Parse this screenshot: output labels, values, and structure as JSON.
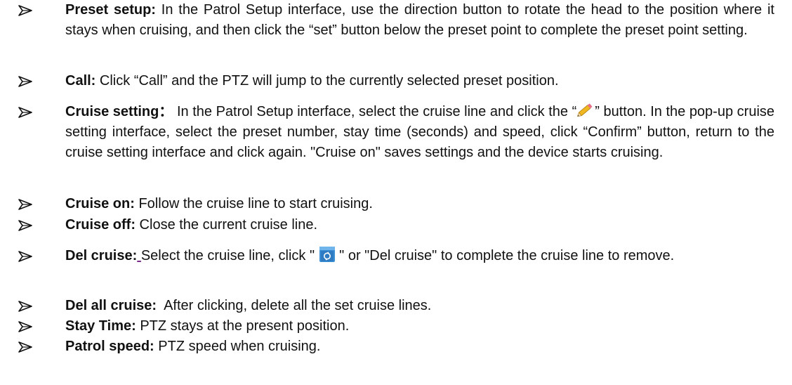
{
  "items": [
    {
      "term": "Preset setup:",
      "text": " In the Patrol Setup interface, use the direction button to rotate the head to the position where it stays when cruising, and then click the “set” button below the preset point to complete the preset point setting."
    },
    {
      "term": "Call:",
      "text": " Click “Call” and the PTZ will jump to the currently selected preset position."
    },
    {
      "term": "Cruise setting：",
      "text_before_icon": " In the Patrol Setup interface, select the cruise line and click the “",
      "icon": "pencil-icon",
      "text_after_icon": "” button. In the pop-up cruise setting interface, select the preset number, stay time (seconds) and speed, click “Confirm” button, return to the cruise setting interface and click again. \"Cruise on\" saves settings and the device starts cruising."
    },
    {
      "term": "Cruise on:",
      "text": " Follow the cruise line to start cruising."
    },
    {
      "term": "Cruise off:",
      "text": " Close the current cruise line."
    },
    {
      "term": "Del cruise",
      "colon": ":",
      "space": " ",
      "text_before_icon": "Select the cruise line, click \" ",
      "icon": "trash-icon",
      "text_after_icon": " \" or \"Del cruise\" to complete the cruise line to remove."
    },
    {
      "term": "Del all cruise:",
      "text": "  After clicking, delete all the set cruise lines."
    },
    {
      "term": "Stay Time:",
      "text": " PTZ stays at the present position."
    },
    {
      "term": "Patrol speed:",
      "text": " PTZ speed when cruising."
    }
  ],
  "colors": {
    "text": "#111111",
    "bullet": "#111111",
    "pencil": "#f0b820",
    "trash": "#3a8fd6"
  }
}
